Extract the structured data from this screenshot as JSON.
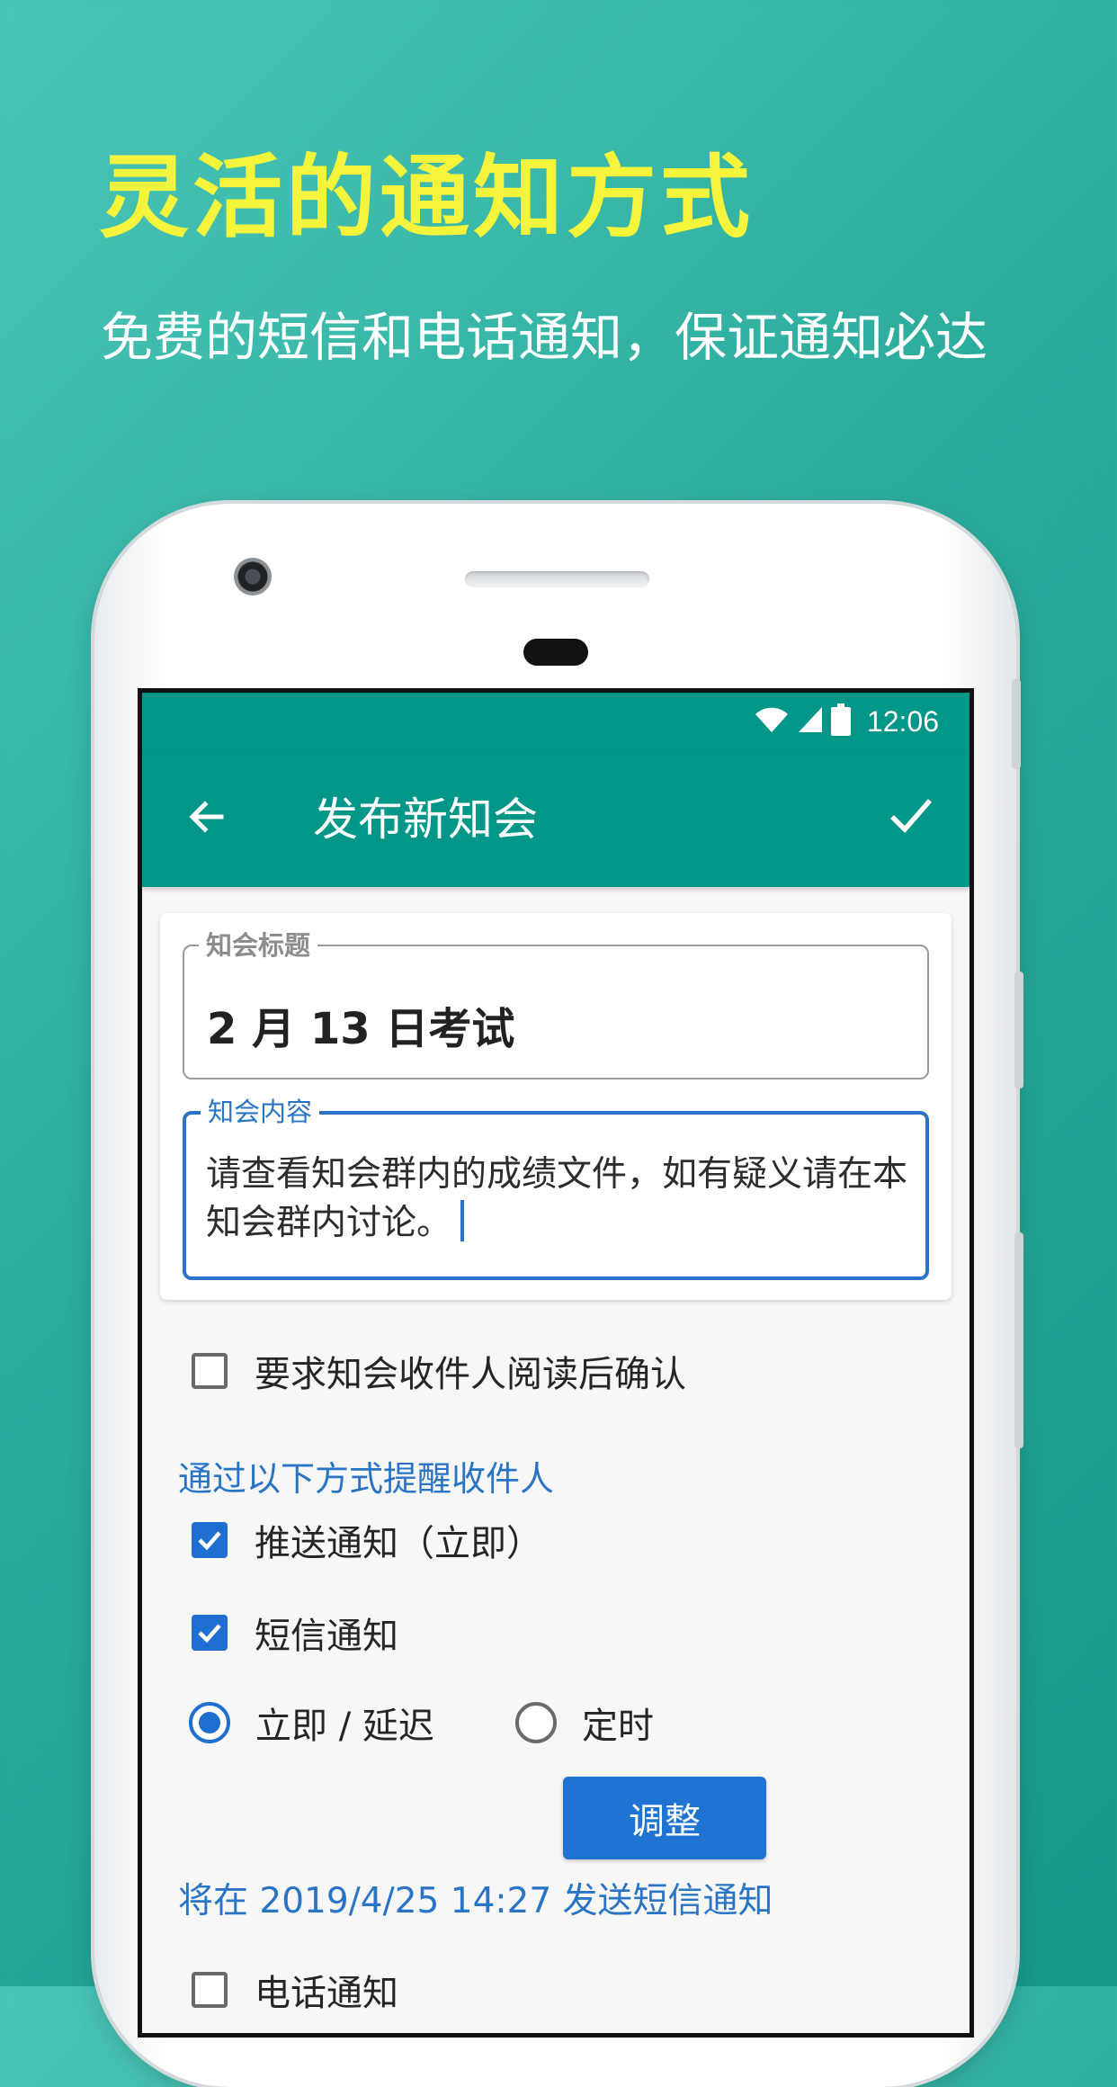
{
  "promo": {
    "headline": "灵活的通知方式",
    "subline": "免费的短信和电话通知，保证通知必达"
  },
  "status_bar": {
    "time": "12:06"
  },
  "app_bar": {
    "title": "发布新知会"
  },
  "form": {
    "title_field": {
      "label": "知会标题",
      "value": "2 月 13 日考试"
    },
    "content_field": {
      "label": "知会内容",
      "value": "请查看知会群内的成绩文件，如有疑义请在本知会群内讨论。"
    },
    "confirm_checkbox": {
      "label": "要求知会收件人阅读后确认",
      "checked": false
    },
    "remind_section_label": "通过以下方式提醒收件人",
    "push_checkbox": {
      "label": "推送通知（立即）",
      "checked": true
    },
    "sms_checkbox": {
      "label": "短信通知",
      "checked": true
    },
    "sms_timing": {
      "option_immediate": "立即 / 延迟",
      "option_scheduled": "定时",
      "selected": "立即 / 延迟",
      "adjust_label": "调整"
    },
    "schedule_text": "将在 2019/4/25 14:27 发送短信通知",
    "phone_checkbox": {
      "label": "电话通知",
      "checked": false
    }
  },
  "colors": {
    "app_teal": "#009688",
    "accent_blue": "#1f6fd1",
    "headline_yellow": "#f4f43c"
  }
}
